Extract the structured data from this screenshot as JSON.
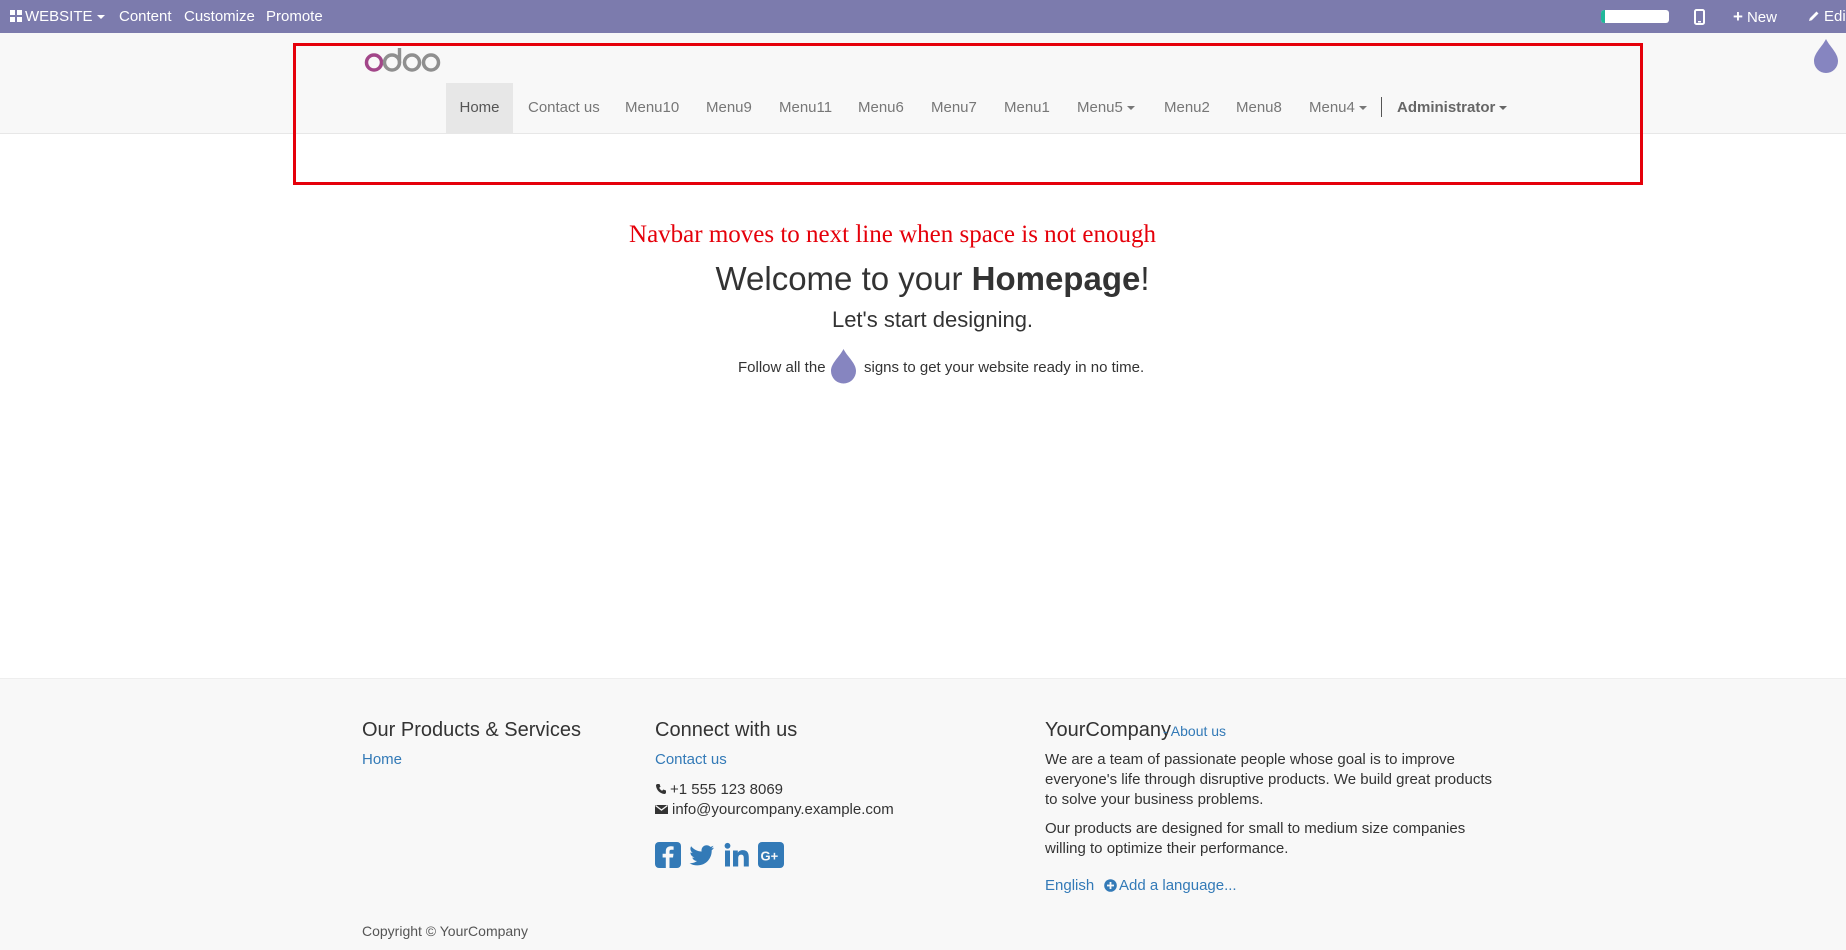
{
  "topbar": {
    "website_label": "WEBSITE",
    "menus": [
      "Content",
      "Customize",
      "Promote"
    ],
    "progress_percent": 6,
    "new_label": "New",
    "edit_label": "Edi"
  },
  "header": {
    "logo_text": "odoo",
    "nav": [
      {
        "label": "Home",
        "active": true
      },
      {
        "label": "Contact us"
      },
      {
        "label": "Menu10"
      },
      {
        "label": "Menu9"
      },
      {
        "label": "Menu11"
      },
      {
        "label": "Menu6"
      },
      {
        "label": "Menu7"
      },
      {
        "label": "Menu1"
      },
      {
        "label": "Menu5",
        "dropdown": true
      },
      {
        "label": "Menu2"
      },
      {
        "label": "Menu8"
      },
      {
        "label": "Menu4",
        "dropdown": true
      }
    ],
    "user_label": "Administrator"
  },
  "main": {
    "annotation": "Navbar moves to next line when space is not enough",
    "welcome_prefix": "Welcome to your ",
    "welcome_bold": "Homepage",
    "welcome_suffix": "!",
    "start": "Let's start designing.",
    "follow_prefix": "Follow all the",
    "follow_suffix": "signs to get your website ready in no time."
  },
  "footer": {
    "products_title": "Our Products & Services",
    "products_link": "Home",
    "connect_title": "Connect with us",
    "contact_link": "Contact us",
    "phone": "+1 555 123 8069",
    "email": "info@yourcompany.example.com",
    "company_name": "YourCompany",
    "about_link": "- About us",
    "about_p1": "We are a team of passionate people whose goal is to improve everyone's life through disruptive products. We build great products to solve your business problems.",
    "about_p2": "Our products are designed for small to medium size companies willing to optimize their performance.",
    "language": "English",
    "add_language": "Add a language...",
    "copyright": "Copyright © YourCompany"
  },
  "colors": {
    "topbar": "#7c7bad",
    "link": "#337ab7",
    "annotation_red": "#e5000a",
    "droplet": "#8685c0"
  }
}
